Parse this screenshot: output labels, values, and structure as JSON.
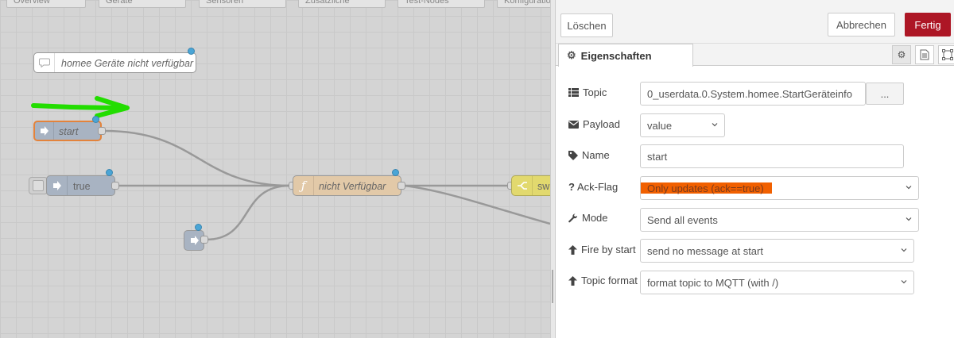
{
  "workspace": {
    "tabs": [
      "Overview",
      "Geräte",
      "Sensoren",
      "Zusätzliche",
      "Test-Nodes",
      "Konfiguration"
    ],
    "comment_node": "homee Geräte nicht verfügbar",
    "inject_node": "start",
    "inject_true_node": "true",
    "function_node": "nicht Verfügbar",
    "switch_node": "sw",
    "annotation_arrow_color": "#22dd00"
  },
  "toolbar": {
    "delete_label": "Löschen",
    "cancel_label": "Abbrechen",
    "done_label": "Fertig"
  },
  "tabs": {
    "properties_label": "Eigenschaften"
  },
  "form": {
    "topic": {
      "label": "Topic",
      "value": "0_userdata.0.System.homee.StartGeräteinfo",
      "browse_label": "..."
    },
    "payload": {
      "label": "Payload",
      "value": "value"
    },
    "name": {
      "label": "Name",
      "value": "start"
    },
    "ack": {
      "label": "Ack-Flag",
      "value": "Only updates (ack==true)"
    },
    "mode": {
      "label": "Mode",
      "value": "Send all events"
    },
    "fire": {
      "label": "Fire by start",
      "value": "send no message at start"
    },
    "topic_format": {
      "label": "Topic format",
      "value": "format topic to MQTT (with /)"
    }
  },
  "colors": {
    "done_button": "#ad1625",
    "highlight": "#f16000",
    "status_dot": "#4aa5d6"
  }
}
